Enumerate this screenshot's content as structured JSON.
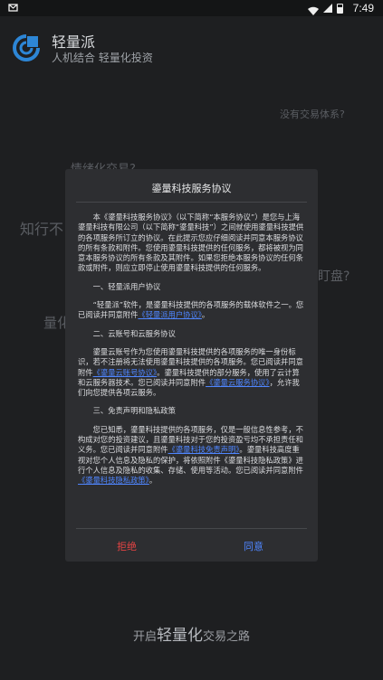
{
  "status_bar": {
    "time": "7:49",
    "icons": [
      "notification-icon",
      "wifi-icon",
      "signal-icon",
      "battery-icon"
    ]
  },
  "app": {
    "title": "轻量派",
    "subtitle": "人机结合 轻量化投资"
  },
  "background": {
    "q_system": "没有交易体系?",
    "q_emotion": "情绪化交易?",
    "q_knowing": "知行不",
    "q_watch": "盯盘?",
    "q_quant": "量化",
    "bottom_pre": "开启",
    "bottom_big": "轻量化",
    "bottom_post": "交易之路"
  },
  "dialog": {
    "title": "鎏量科技服务协议",
    "intro": "本《鎏量科技服务协议》（以下简称“本服务协议”）是您与上海鎏量科技有限公司（以下简称“鎏量科技”）之间就使用鎏量科技提供的各项服务所订立的协议。在此提示您应仔细阅读并同意本服务协议的所有条款和附件。您使用鎏量科技提供的任何服务，都将被视为同意本服务协议的所有条款及其附件。如果您拒绝本服务协议的任何条款或附件，则应立即停止使用鎏量科技提供的任何服务。",
    "sec1_title": "一、轻量派用户协议",
    "sec1_a": "“轻量派”软件，是鎏量科技提供的各项服务的载体软件之一。您已阅读并同意附件",
    "sec1_link": "《轻量派用户协议》",
    "sec1_b": "。",
    "sec2_title": "二、云账号和云服务协议",
    "sec2_a": "鎏量云账号作为您使用鎏量科技提供的各项服务的唯一身份标识，若不注册将无法使用鎏量科技提供的各项服务。您已阅读并同意附件",
    "sec2_link1": "《鎏量云账号协议》",
    "sec2_b": "。鎏量科技提供的部分服务，使用了云计算和云服务器技术。您已阅读并同意附件",
    "sec2_link2": "《鎏量云服务协议》",
    "sec2_c": "，允许我们向您提供各项云服务。",
    "sec3_title": "三、免责声明和隐私政策",
    "sec3_a": "您已知悉，鎏量科技提供的各项服务，仅是一般信息性参考，不构成对您的投资建议，且鎏量科技对于您的投资盈亏均不承担责任和义务。您已阅读并同意附件",
    "sec3_link1": "《鎏量科技免责声明》",
    "sec3_b": "。鎏量科技高度重视对您个人信息及隐私的保护，将依照附件《鎏量科技隐私政策》进行个人信息及隐私的收集、存储、使用等活动。您已阅读并同意附件",
    "sec3_link2": "《鎏量科技隐私政策》",
    "sec3_c": "。",
    "reject": "拒绝",
    "agree": "同意"
  }
}
